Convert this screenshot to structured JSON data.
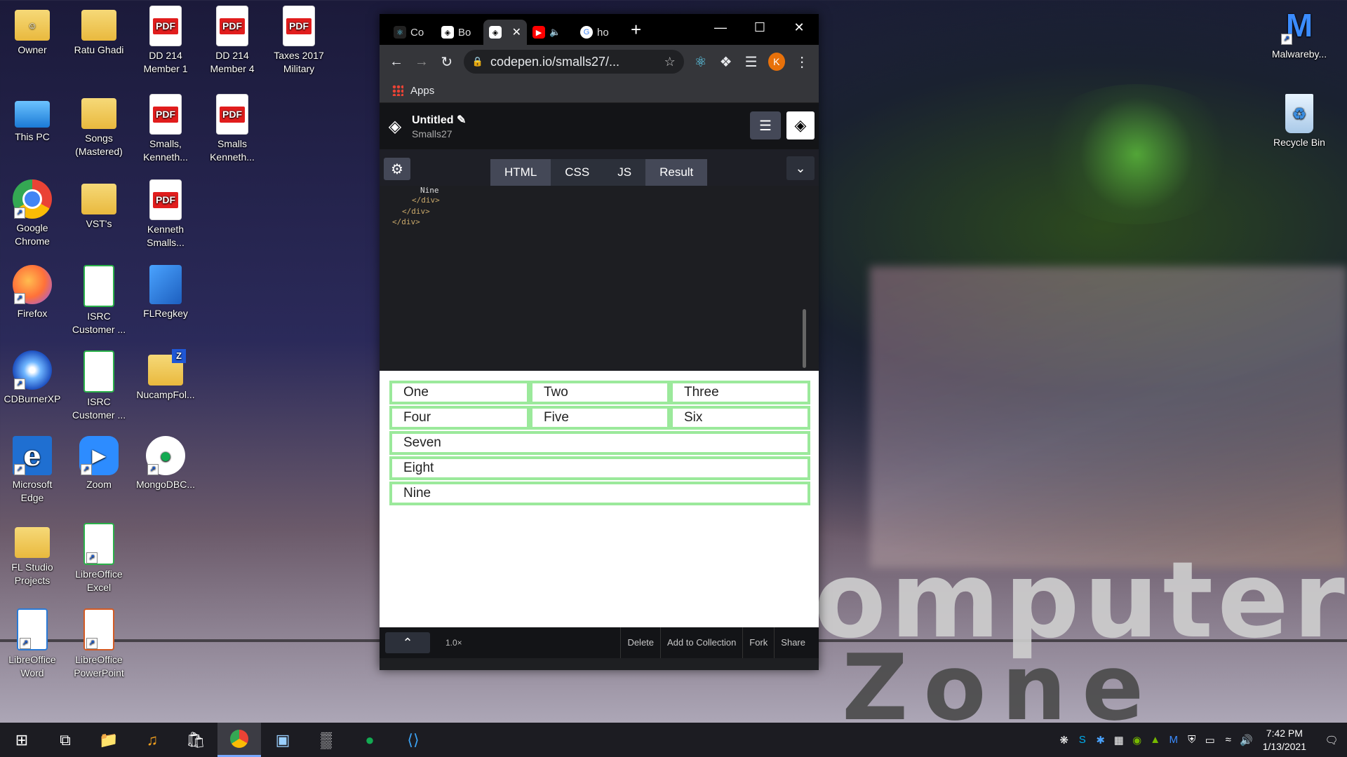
{
  "desktop_icons": [
    {
      "label": "Owner",
      "icon": "user-folder-icon"
    },
    {
      "label": "Ratu Ghadi",
      "icon": "folder-icon"
    },
    {
      "label": "DD 214 Member 1",
      "icon": "pdf-icon"
    },
    {
      "label": "DD 214 Member 4",
      "icon": "pdf-icon"
    },
    {
      "label": "Taxes 2017 Military",
      "icon": "pdf-icon"
    },
    {
      "label": "This PC",
      "icon": "computer-icon"
    },
    {
      "label": "Songs (Mastered)",
      "icon": "folder-icon"
    },
    {
      "label": "Smalls, Kenneth...",
      "icon": "pdf-icon"
    },
    {
      "label": "Smalls Kenneth...",
      "icon": "pdf-icon"
    },
    {
      "label": "Google Chrome",
      "icon": "chrome-icon"
    },
    {
      "label": "VST's",
      "icon": "folder-icon"
    },
    {
      "label": "Kenneth Smalls...",
      "icon": "pdf-icon"
    },
    {
      "label": "Firefox",
      "icon": "firefox-icon"
    },
    {
      "label": "ISRC Customer ...",
      "icon": "spreadsheet-icon"
    },
    {
      "label": "FLRegkey",
      "icon": "registry-icon"
    },
    {
      "label": "CDBurnerXP",
      "icon": "cd-icon"
    },
    {
      "label": "ISRC Customer ...",
      "icon": "spreadsheet-icon"
    },
    {
      "label": "NucampFol...",
      "icon": "zip-folder-icon"
    },
    {
      "label": "Microsoft Edge",
      "icon": "edge-icon"
    },
    {
      "label": "Zoom",
      "icon": "zoom-icon"
    },
    {
      "label": "MongoDBC...",
      "icon": "mongodb-icon"
    },
    {
      "label": "FL Studio Projects",
      "icon": "folder-icon"
    },
    {
      "label": "LibreOffice Excel",
      "icon": "spreadsheet-icon"
    },
    {
      "label": "LibreOffice Word",
      "icon": "writer-icon"
    },
    {
      "label": "LibreOffice PowerPoint",
      "icon": "impress-icon"
    },
    {
      "label": "Malwareby...",
      "icon": "malwarebytes-icon"
    },
    {
      "label": "Recycle Bin",
      "icon": "recycle-bin-icon"
    }
  ],
  "pdf_badge": "PDF",
  "wallpaper": {
    "line1": "omputer",
    "line2": "Zone"
  },
  "browser": {
    "tabs": [
      {
        "label": "Co",
        "icon": "react-icon"
      },
      {
        "label": "Bo",
        "icon": "codepen-icon"
      },
      {
        "label": "",
        "icon": "codepen-icon",
        "active": true
      },
      {
        "label": "",
        "icon": "youtube-icon"
      },
      {
        "label": "ho",
        "icon": "google-icon"
      }
    ],
    "url": "codepen.io/smalls27/...",
    "profile_initial": "K",
    "bookmarks_label": "Apps"
  },
  "codepen": {
    "title": "Untitled",
    "user": "Smalls27",
    "tabs": [
      "HTML",
      "CSS",
      "JS",
      "Result"
    ],
    "code_lines": [
      "Nine",
      "</div>",
      "</div>",
      "</div>"
    ],
    "result_cells": [
      "One",
      "Two",
      "Three",
      "Four",
      "Five",
      "Six",
      "Seven",
      "Eight",
      "Nine"
    ],
    "footer": {
      "zoom": "1.0×",
      "delete": "Delete",
      "add_to_collection": "Add to Collection",
      "fork": "Fork",
      "share": "Share"
    }
  },
  "taskbar": {
    "time": "7:42 PM",
    "date": "1/13/2021"
  },
  "colors": {
    "cell_border": "#9be99b",
    "accent": "#79a8ff"
  }
}
